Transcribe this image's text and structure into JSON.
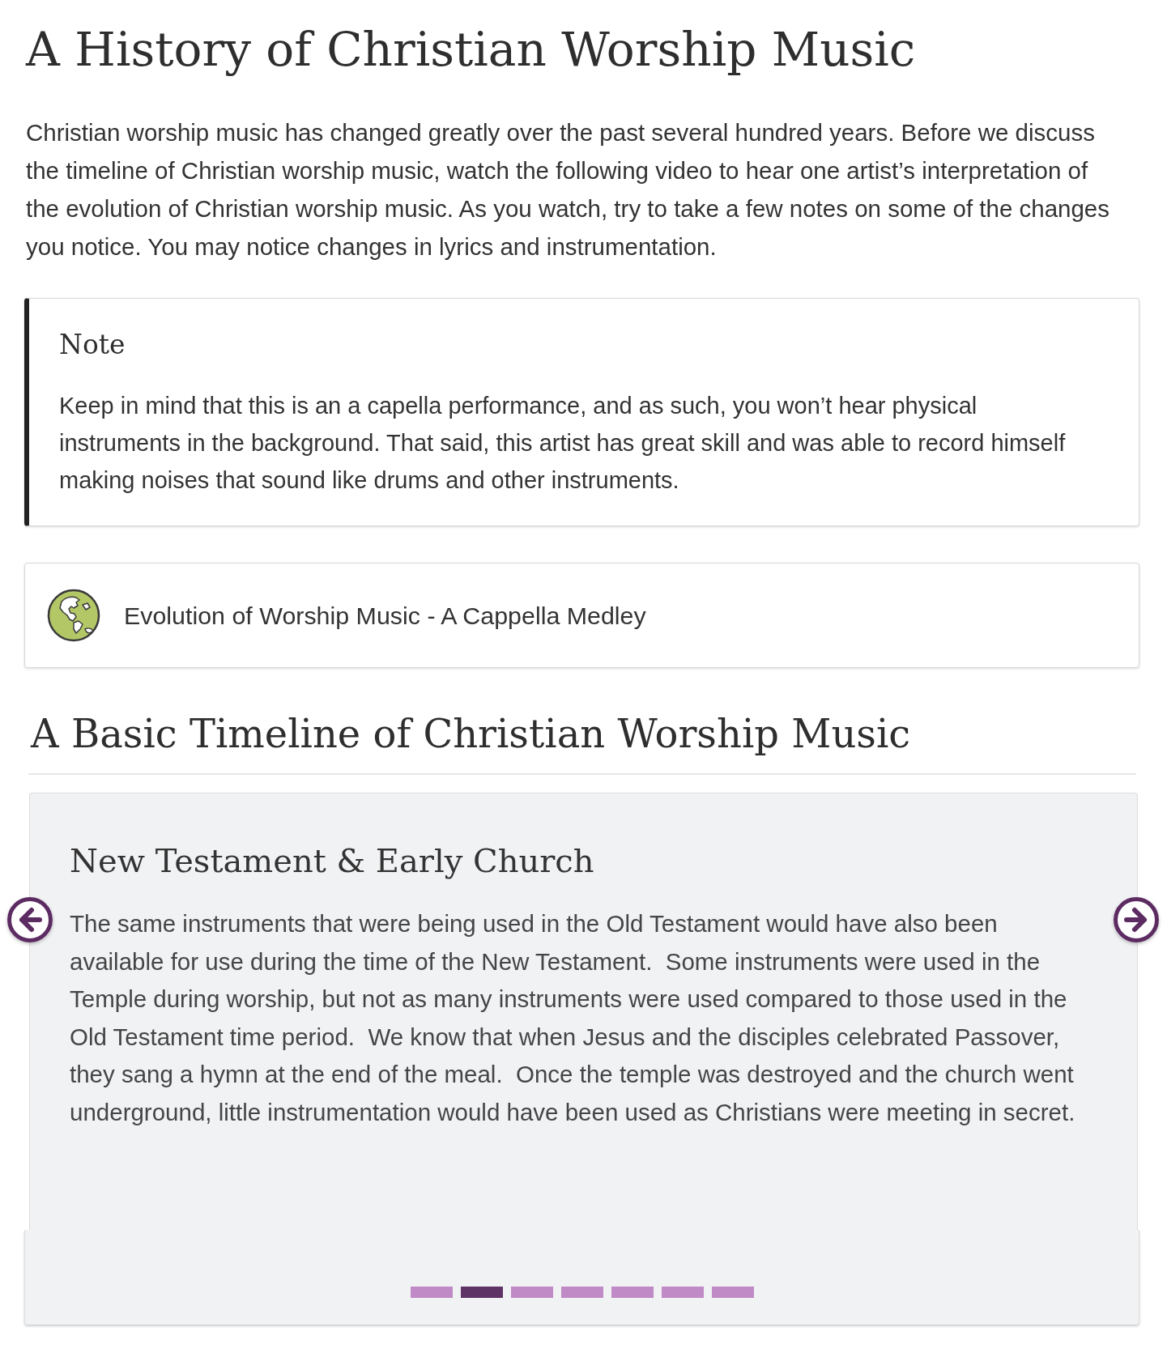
{
  "page": {
    "title": "A History of Christian Worship Music",
    "intro": "Christian worship music has changed greatly over the past several hundred years. Before we discuss the timeline of Christian worship music, watch the following video to hear one artist’s interpretation of the evolution of Christian worship music. As you watch, try to take a few notes on some of the changes you notice. You may notice changes in lyrics and instrumentation."
  },
  "note": {
    "heading": "Note",
    "body": "Keep in mind that this is an a capella performance, and as such, you won’t hear physical instruments in the background. That said, this artist has great skill and was able to record himself making noises that sound like drums and other instruments."
  },
  "link": {
    "label": "Evolution of Worship Music - A Cappella Medley"
  },
  "timeline": {
    "heading": "A Basic Timeline of Christian Worship Music",
    "slide": {
      "title": "New Testament & Early Church",
      "body": "The same instruments that were being used in the Old Testament would have also been available for use during the time of the New Testament.  Some instruments were used in the Temple during worship, but not as many instruments were used compared to those used in the Old Testament time period.  We know that when Jesus and the disciples celebrated Passover, they sang a hymn at the end of the meal.  Once the temple was destroyed and the church went underground, little instrumentation would have been used as Christians were meeting in secret."
    },
    "pages": [
      {
        "selected": false
      },
      {
        "selected": true
      },
      {
        "selected": false
      },
      {
        "selected": false
      },
      {
        "selected": false
      },
      {
        "selected": false
      },
      {
        "selected": false
      }
    ]
  }
}
